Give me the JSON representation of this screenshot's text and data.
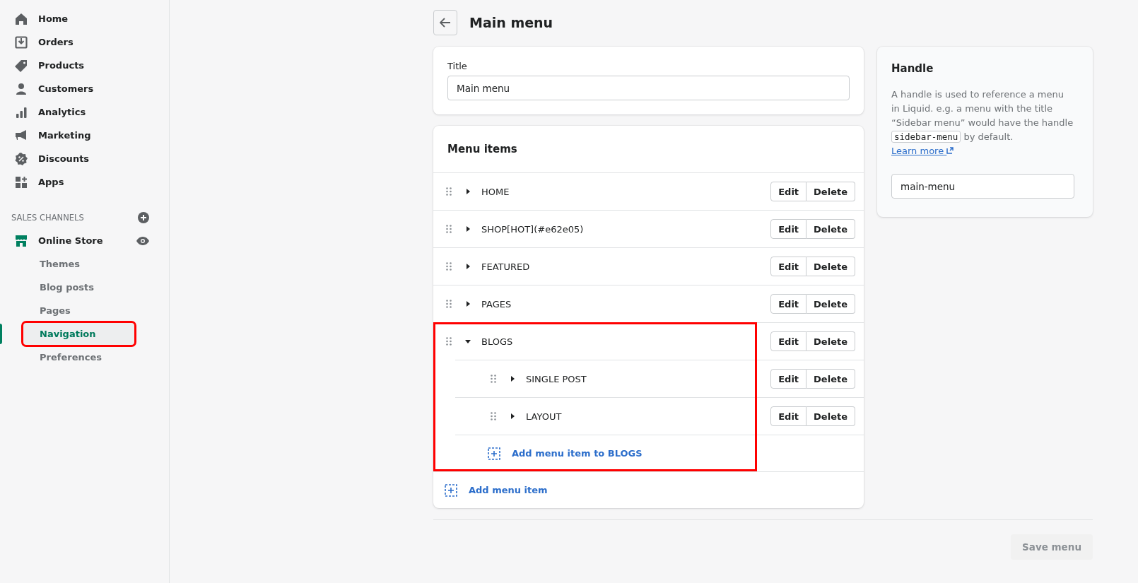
{
  "sidebar": {
    "items": [
      {
        "label": "Home",
        "selected": false
      },
      {
        "label": "Orders",
        "selected": false
      },
      {
        "label": "Products",
        "selected": false
      },
      {
        "label": "Customers",
        "selected": false
      },
      {
        "label": "Analytics",
        "selected": false
      },
      {
        "label": "Marketing",
        "selected": false
      },
      {
        "label": "Discounts",
        "selected": false
      },
      {
        "label": "Apps",
        "selected": false
      }
    ],
    "section_title": "SALES CHANNELS",
    "channel": {
      "label": "Online Store",
      "selected": false
    },
    "sub_items": [
      {
        "label": "Themes",
        "selected": false,
        "highlighted": false
      },
      {
        "label": "Blog posts",
        "selected": false,
        "highlighted": false
      },
      {
        "label": "Pages",
        "selected": false,
        "highlighted": false
      },
      {
        "label": "Navigation",
        "selected": true,
        "highlighted": true
      },
      {
        "label": "Preferences",
        "selected": false,
        "highlighted": false
      }
    ]
  },
  "page_title": "Main menu",
  "title_card": {
    "label": "Title",
    "value": "Main menu"
  },
  "menu_card": {
    "heading": "Menu items",
    "items": [
      {
        "label": "HOME",
        "expanded": false,
        "highlighted": false,
        "edit_label": "Edit",
        "delete_label": "Delete"
      },
      {
        "label": "SHOP[HOT](#e62e05)",
        "expanded": false,
        "highlighted": false,
        "edit_label": "Edit",
        "delete_label": "Delete"
      },
      {
        "label": "FEATURED",
        "expanded": false,
        "highlighted": false,
        "edit_label": "Edit",
        "delete_label": "Delete"
      },
      {
        "label": "PAGES",
        "expanded": false,
        "highlighted": false,
        "edit_label": "Edit",
        "delete_label": "Delete"
      },
      {
        "label": "BLOGS",
        "expanded": true,
        "highlighted": true,
        "edit_label": "Edit",
        "delete_label": "Delete",
        "add_child": "Add menu item to BLOGS",
        "children": [
          {
            "label": "SINGLE POST",
            "expanded": false,
            "edit_label": "Edit",
            "delete_label": "Delete"
          },
          {
            "label": "LAYOUT",
            "expanded": false,
            "edit_label": "Edit",
            "delete_label": "Delete"
          }
        ]
      }
    ],
    "add_item": "Add menu item"
  },
  "handle_card": {
    "heading": "Handle",
    "description_before": "A handle is used to reference a menu in Liquid. e.g. a menu with the title “Sidebar menu” would have the handle",
    "code": "sidebar-menu",
    "description_after": "by default.",
    "link": "Learn more",
    "value": "main-menu"
  },
  "save_button": {
    "label": "Save menu",
    "disabled": true
  }
}
